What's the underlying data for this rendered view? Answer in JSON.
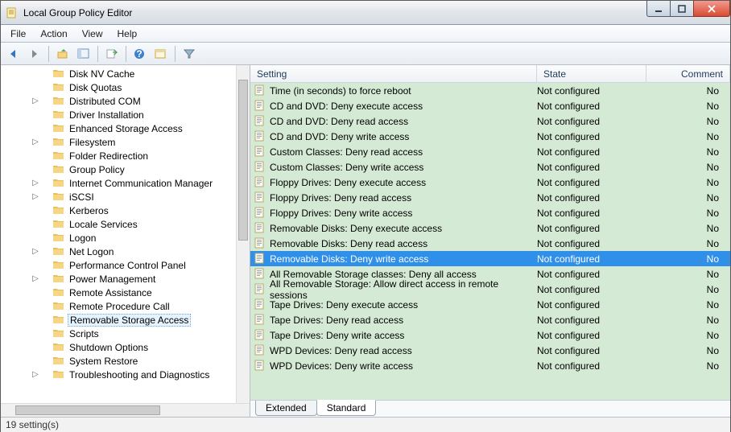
{
  "window": {
    "title": "Local Group Policy Editor"
  },
  "menu": {
    "file": "File",
    "action": "Action",
    "view": "View",
    "help": "Help"
  },
  "status": {
    "text": "19 setting(s)"
  },
  "tabs": {
    "extended": "Extended",
    "standard": "Standard"
  },
  "columns": {
    "setting": "Setting",
    "state": "State",
    "comment": "Comment"
  },
  "tree": [
    {
      "label": "Disk NV Cache",
      "exp": ""
    },
    {
      "label": "Disk Quotas",
      "exp": ""
    },
    {
      "label": "Distributed COM",
      "exp": "▷"
    },
    {
      "label": "Driver Installation",
      "exp": ""
    },
    {
      "label": "Enhanced Storage Access",
      "exp": ""
    },
    {
      "label": "Filesystem",
      "exp": "▷"
    },
    {
      "label": "Folder Redirection",
      "exp": ""
    },
    {
      "label": "Group Policy",
      "exp": ""
    },
    {
      "label": "Internet Communication Manager",
      "exp": "▷"
    },
    {
      "label": "iSCSI",
      "exp": "▷"
    },
    {
      "label": "Kerberos",
      "exp": ""
    },
    {
      "label": "Locale Services",
      "exp": ""
    },
    {
      "label": "Logon",
      "exp": ""
    },
    {
      "label": "Net Logon",
      "exp": "▷"
    },
    {
      "label": "Performance Control Panel",
      "exp": ""
    },
    {
      "label": "Power Management",
      "exp": "▷"
    },
    {
      "label": "Remote Assistance",
      "exp": ""
    },
    {
      "label": "Remote Procedure Call",
      "exp": ""
    },
    {
      "label": "Removable Storage Access",
      "exp": "",
      "sel": true
    },
    {
      "label": "Scripts",
      "exp": ""
    },
    {
      "label": "Shutdown Options",
      "exp": ""
    },
    {
      "label": "System Restore",
      "exp": ""
    },
    {
      "label": "Troubleshooting and Diagnostics",
      "exp": "▷"
    }
  ],
  "rows": [
    {
      "setting": "Time (in seconds) to force reboot",
      "state": "Not configured",
      "comment": "No"
    },
    {
      "setting": "CD and DVD: Deny execute access",
      "state": "Not configured",
      "comment": "No"
    },
    {
      "setting": "CD and DVD: Deny read access",
      "state": "Not configured",
      "comment": "No"
    },
    {
      "setting": "CD and DVD: Deny write access",
      "state": "Not configured",
      "comment": "No"
    },
    {
      "setting": "Custom Classes: Deny read access",
      "state": "Not configured",
      "comment": "No"
    },
    {
      "setting": "Custom Classes: Deny write access",
      "state": "Not configured",
      "comment": "No"
    },
    {
      "setting": "Floppy Drives: Deny execute access",
      "state": "Not configured",
      "comment": "No"
    },
    {
      "setting": "Floppy Drives: Deny read access",
      "state": "Not configured",
      "comment": "No"
    },
    {
      "setting": "Floppy Drives: Deny write access",
      "state": "Not configured",
      "comment": "No"
    },
    {
      "setting": "Removable Disks: Deny execute access",
      "state": "Not configured",
      "comment": "No"
    },
    {
      "setting": "Removable Disks: Deny read access",
      "state": "Not configured",
      "comment": "No"
    },
    {
      "setting": "Removable Disks: Deny write access",
      "state": "Not configured",
      "comment": "No",
      "sel": true
    },
    {
      "setting": "All Removable Storage classes: Deny all access",
      "state": "Not configured",
      "comment": "No"
    },
    {
      "setting": "All Removable Storage: Allow direct access in remote sessions",
      "state": "Not configured",
      "comment": "No"
    },
    {
      "setting": "Tape Drives: Deny execute access",
      "state": "Not configured",
      "comment": "No"
    },
    {
      "setting": "Tape Drives: Deny read access",
      "state": "Not configured",
      "comment": "No"
    },
    {
      "setting": "Tape Drives: Deny write access",
      "state": "Not configured",
      "comment": "No"
    },
    {
      "setting": "WPD Devices: Deny read access",
      "state": "Not configured",
      "comment": "No"
    },
    {
      "setting": "WPD Devices: Deny write access",
      "state": "Not configured",
      "comment": "No"
    }
  ]
}
